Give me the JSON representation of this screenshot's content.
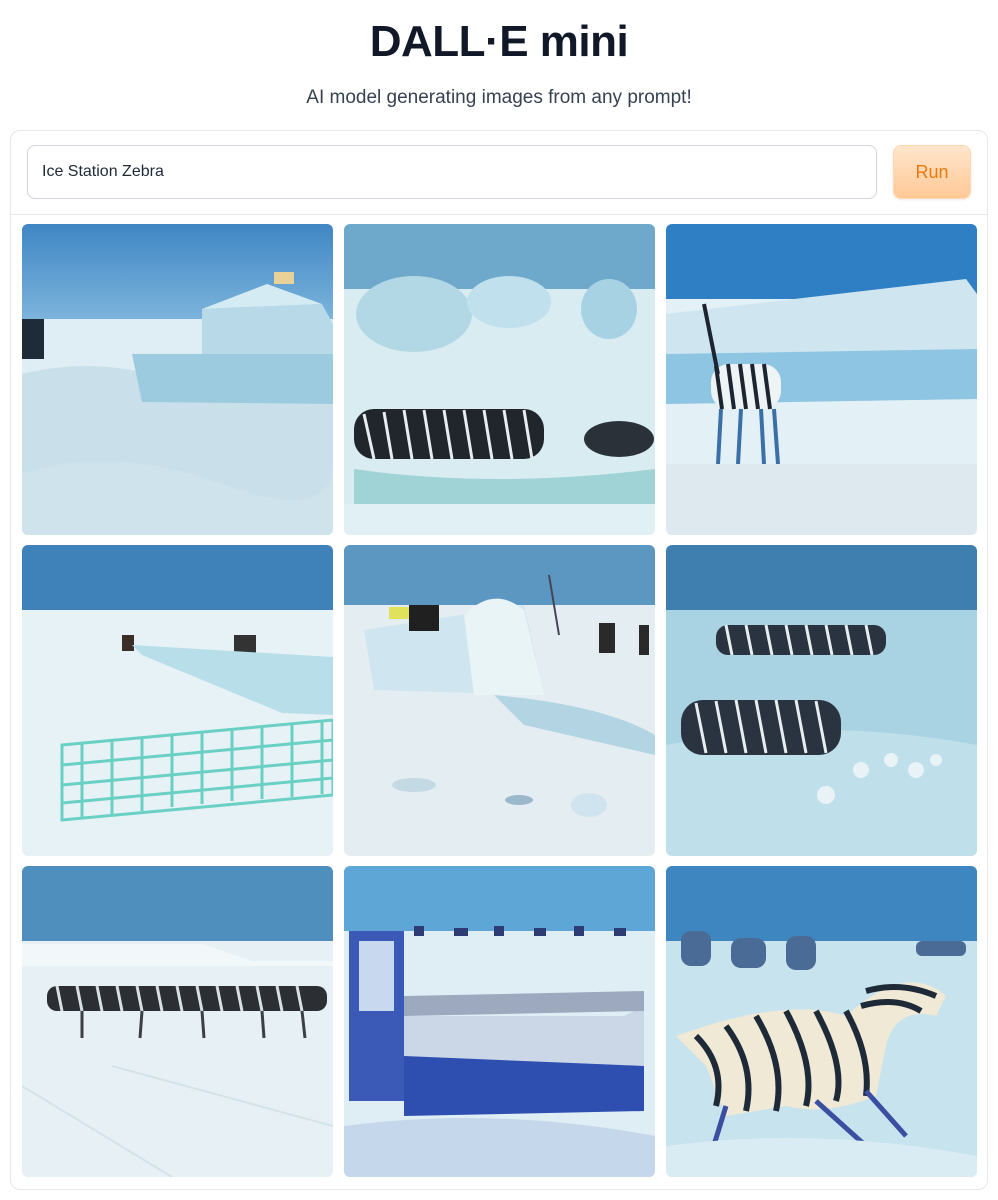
{
  "header": {
    "title": "DALL·E mini",
    "subtitle": "AI model generating images from any prompt!"
  },
  "prompt": {
    "value": "Ice Station Zebra",
    "placeholder": ""
  },
  "run_button": {
    "label": "Run"
  },
  "colors": {
    "accent": "#ea7a10",
    "button_bg": "#ffd7ad",
    "sky": "#4e95c7",
    "snow": "#e2f0f4",
    "ice": "#a8d4e6"
  },
  "gallery": {
    "images": [
      {
        "subject": "ice block structure with flag on snowfield"
      },
      {
        "subject": "zebras lying near ice blocks"
      },
      {
        "subject": "zebra standing before ice wall"
      },
      {
        "subject": "snow fences and distant huts"
      },
      {
        "subject": "people around snow mound"
      },
      {
        "subject": "zebras grazing on icy plain"
      },
      {
        "subject": "herd of zebras crossing snowfield"
      },
      {
        "subject": "blue and white cabin on ice"
      },
      {
        "subject": "large zebra running in snow"
      }
    ]
  }
}
